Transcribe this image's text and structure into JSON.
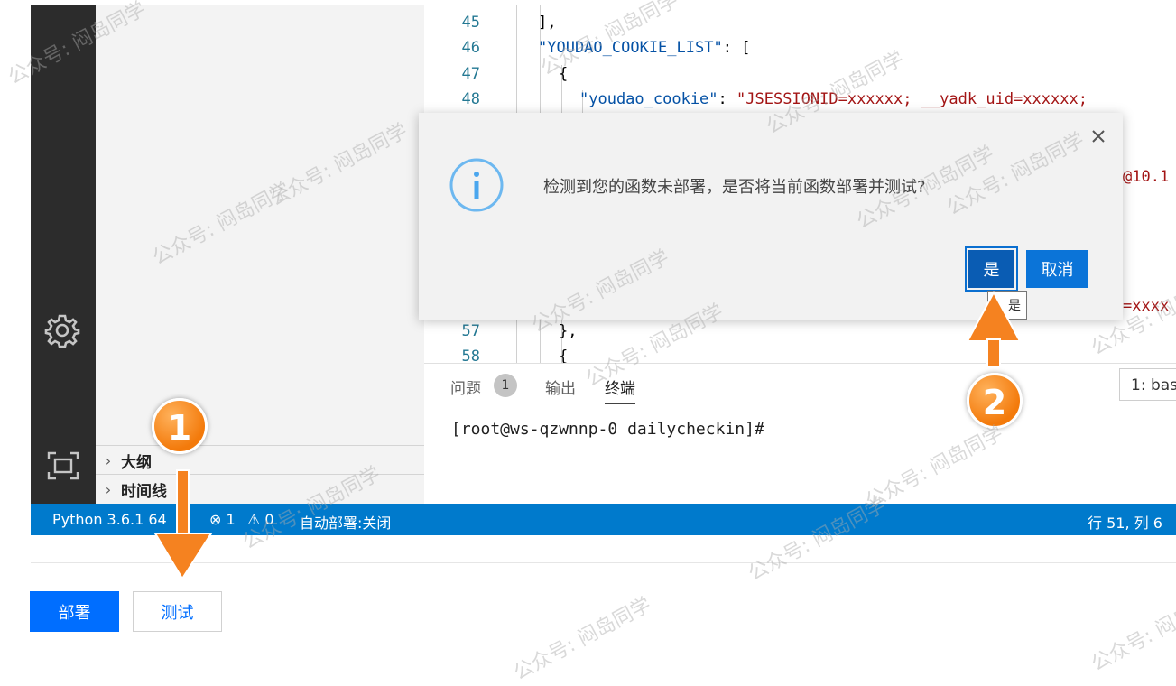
{
  "editor": {
    "lines": [
      {
        "num": "45",
        "indent": 1,
        "parts": [
          {
            "t": "],",
            "c": "p"
          }
        ]
      },
      {
        "num": "46",
        "indent": 1,
        "parts": [
          {
            "t": "\"YOUDAO_COOKIE_LIST\"",
            "c": "k"
          },
          {
            "t": ": [",
            "c": "p"
          }
        ]
      },
      {
        "num": "47",
        "indent": 2,
        "parts": [
          {
            "t": "{",
            "c": "p"
          }
        ]
      },
      {
        "num": "48",
        "indent": 3,
        "parts": [
          {
            "t": "\"youdao_cookie\"",
            "c": "k"
          },
          {
            "t": ": ",
            "c": "p"
          },
          {
            "t": "\"JSESSIONID=xxxxxx; __yadk_uid=xxxxxx;",
            "c": "s"
          }
        ]
      },
      {
        "num": "57",
        "indent": 2,
        "parts": [
          {
            "t": "},",
            "c": "p"
          }
        ]
      },
      {
        "num": "58",
        "indent": 2,
        "parts": [
          {
            "t": "{",
            "c": "p"
          }
        ]
      }
    ],
    "partial_right_1": "@10.1",
    "partial_right_2": "=xxxx"
  },
  "sidebar": {
    "outline_label": "大纲",
    "timeline_label": "时间线"
  },
  "panel": {
    "tab_problems": "问题",
    "problems_count": "1",
    "tab_output": "输出",
    "tab_terminal": "终端",
    "terminal_select": "1: bas",
    "terminal_prompt": "[root@ws-qzwnnp-0 dailycheckin]#"
  },
  "statusbar": {
    "python": "Python 3.6.1 64",
    "errors": "⊗ 1",
    "warnings": "⚠ 0",
    "auto_deploy": "自动部署:关闭",
    "position": "行 51, 列 6"
  },
  "footer": {
    "deploy_label": "部署",
    "test_label": "测试"
  },
  "modal": {
    "message": "检测到您的函数未部署，是否将当前函数部署并测试?",
    "yes_label": "是",
    "cancel_label": "取消",
    "tooltip": "是"
  },
  "annotations": {
    "step1": "1",
    "step2": "2",
    "arrow_color": "#f58220"
  },
  "watermark": "公众号: 闷岛同学"
}
